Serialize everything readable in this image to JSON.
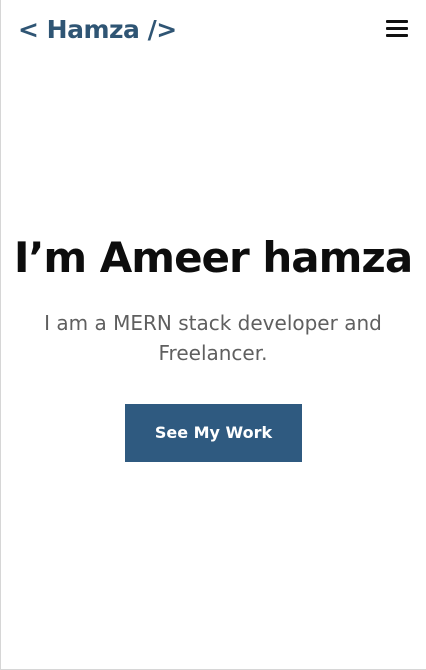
{
  "navbar": {
    "logo_text": "< Hamza />",
    "menu_icon": "hamburger-menu-icon"
  },
  "hero": {
    "title": "I’m Ameer hamza",
    "subtitle": "I am a MERN stack developer and Freelancer.",
    "cta_label": "See My Work"
  },
  "colors": {
    "brand": "#2f5574",
    "button": "#2f5a80",
    "title": "#0d0d0d",
    "subtitle": "#5f5f5f",
    "background": "#ffffff"
  }
}
